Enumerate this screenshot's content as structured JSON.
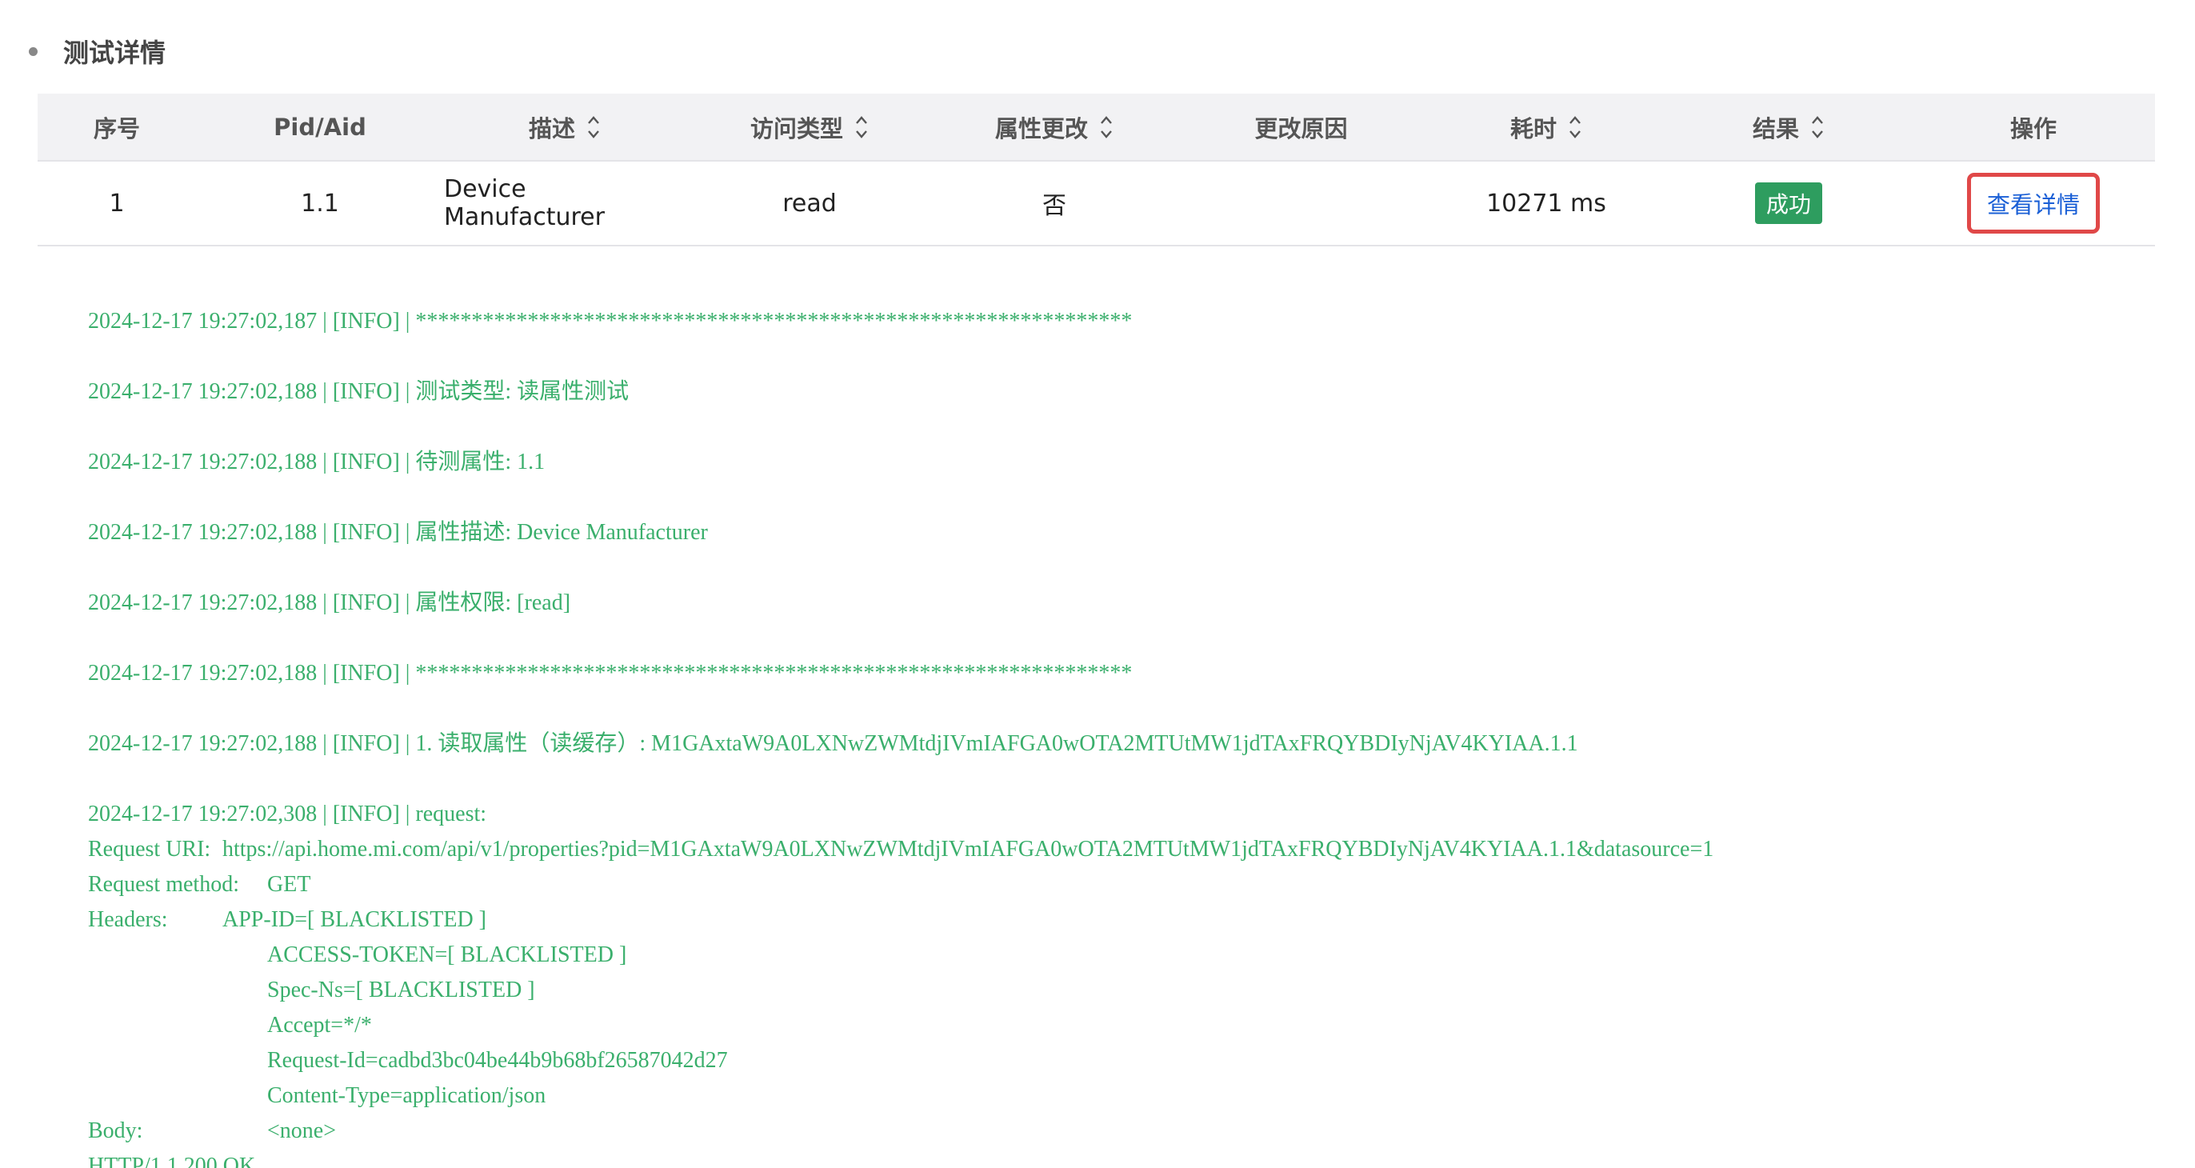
{
  "section": {
    "title": "测试详情"
  },
  "table": {
    "headers": {
      "index": "序号",
      "pid_aid": "Pid/Aid",
      "description": "描述",
      "access_type": "访问类型",
      "attr_changed": "属性更改",
      "change_reason": "更改原因",
      "duration": "耗时",
      "result": "结果",
      "action": "操作"
    },
    "rows": [
      {
        "index": "1",
        "pid_aid": "1.1",
        "description": "Device Manufacturer",
        "access_type": "read",
        "attr_changed": "否",
        "change_reason": "",
        "duration": "10271 ms",
        "result": "成功",
        "action": "查看详情"
      }
    ]
  },
  "colors": {
    "success_badge": "#2e9d5f",
    "log_text": "#3aaf6c",
    "link": "#1a5fd6",
    "highlight_border": "#e04848"
  },
  "log": {
    "lines": [
      "2024-12-17 19:27:02,187 | [INFO] | ****************************************************************",
      "2024-12-17 19:27:02,188 | [INFO] | 测试类型: 读属性测试",
      "2024-12-17 19:27:02,188 | [INFO] | 待测属性: 1.1",
      "2024-12-17 19:27:02,188 | [INFO] | 属性描述: Device Manufacturer",
      "2024-12-17 19:27:02,188 | [INFO] | 属性权限: [read]",
      "2024-12-17 19:27:02,188 | [INFO] | ****************************************************************",
      "2024-12-17 19:27:02,188 | [INFO] | 1. 读取属性（读缓存）: M1GAxtaW9A0LXNwZWMtdjIVmIAFGA0wOTA2MTUtMW1jdTAxFRQYBDIyNjAV4KYIAA.1.1",
      "2024-12-17 19:27:02,308 | [INFO] | request:"
    ],
    "request": {
      "uri_label": "Request URI:",
      "uri_value": "https://api.home.mi.com/api/v1/properties?pid=M1GAxtaW9A0LXNwZWMtdjIVmIAFGA0wOTA2MTUtMW1jdTAxFRQYBDIyNjAV4KYIAA.1.1&datasource=1",
      "method_label": "Request method:",
      "method_value": "GET",
      "headers_label": "Headers:",
      "headers": [
        "APP-ID=[ BLACKLISTED ]",
        "ACCESS-TOKEN=[ BLACKLISTED ]",
        "Spec-Ns=[ BLACKLISTED ]",
        "Accept=*/*",
        "Request-Id=cadbd3bc04be44b9b68bf26587042d27",
        "Content-Type=application/json"
      ],
      "body_label": "Body:",
      "body_value": "<none>",
      "status_line": "HTTP/1.1 200 OK"
    }
  }
}
